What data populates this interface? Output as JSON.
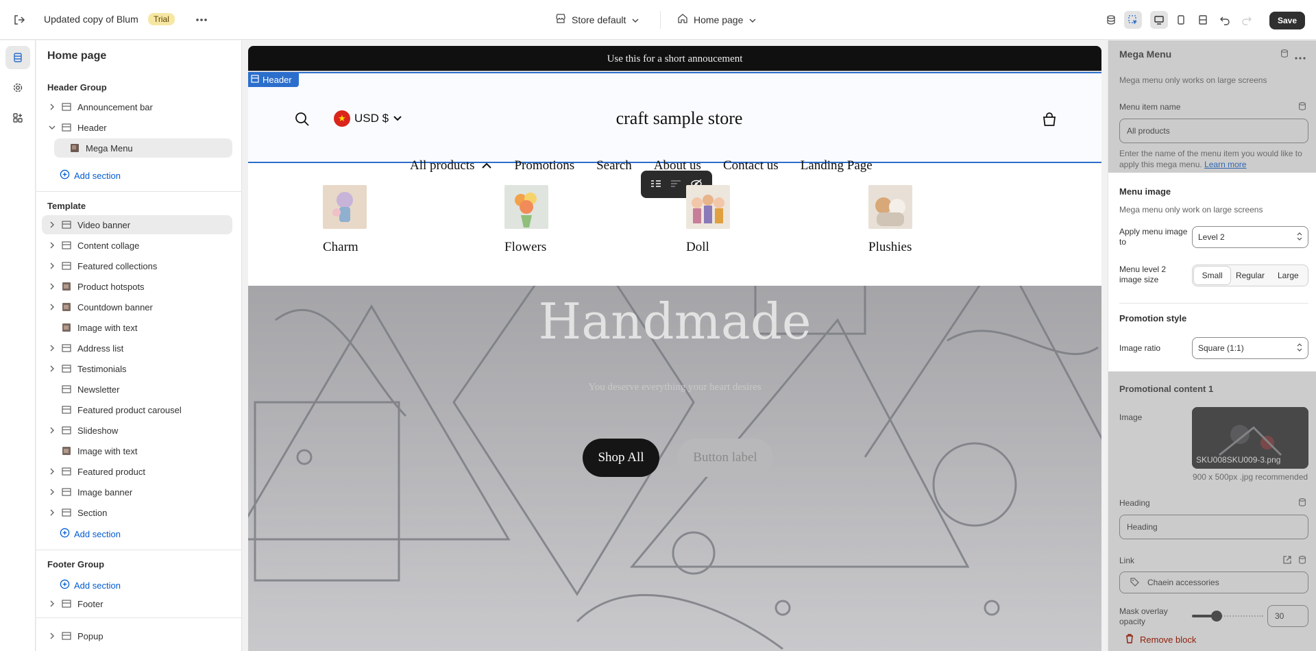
{
  "topbar": {
    "title": "Updated copy of Blum",
    "badge": "Trial",
    "store_selector": "Store default",
    "page_selector": "Home page",
    "save_label": "Save"
  },
  "sidebar": {
    "title": "Home page",
    "header_group": {
      "label": "Header Group",
      "items": [
        "Announcement bar",
        "Header",
        "Mega Menu"
      ],
      "add": "Add section"
    },
    "template": {
      "label": "Template",
      "items": [
        "Video banner",
        "Content collage",
        "Featured collections",
        "Product hotspots",
        "Countdown banner",
        "Image with text",
        "Address list",
        "Testimonials",
        "Newsletter",
        "Featured product carousel",
        "Slideshow",
        "Image with text",
        "Featured product",
        "Image banner",
        "Section"
      ],
      "add": "Add section"
    },
    "footer_group": {
      "label": "Footer Group",
      "add": "Add section",
      "items": [
        "Footer"
      ]
    },
    "popup": "Popup"
  },
  "preview": {
    "announcement": "Use this for a short annoucement",
    "header_tag": "Header",
    "currency": "USD $",
    "store_name": "craft sample store",
    "nav": [
      "All products",
      "Promotions",
      "Search",
      "About us",
      "Contact us",
      "Landing Page"
    ],
    "mega_items": [
      "Charm",
      "Flowers",
      "Doll",
      "Plushies"
    ],
    "hero_title": "Handmade",
    "hero_subtitle": "You deserve everything your heart desires",
    "hero_btn_primary": "Shop All",
    "hero_btn_secondary": "Button label"
  },
  "panel": {
    "title": "Mega Menu",
    "intro": "Mega menu only works on large screens",
    "menu_item_name_label": "Menu item name",
    "menu_item_name_value": "All products",
    "menu_item_help": "Enter the name of the menu item you would like to apply this mega menu.",
    "learn_more": "Learn more",
    "menu_image_heading": "Menu image",
    "menu_image_help": "Mega menu only work on large screens",
    "apply_label": "Apply menu image to",
    "apply_value": "Level 2",
    "size_label": "Menu level 2 image size",
    "size_options": [
      "Small",
      "Regular",
      "Large"
    ],
    "size_selected": "Small",
    "promo_heading": "Promotion style",
    "ratio_label": "Image ratio",
    "ratio_value": "Square (1:1)",
    "promo_content_heading": "Promotional content 1",
    "image_label": "Image",
    "image_filename": "SKU008SKU009-3.png",
    "image_hint": "900 x 500px .jpg recommended",
    "heading_label": "Heading",
    "heading_value": "Heading",
    "link_label": "Link",
    "link_value": "Chaein accessories",
    "overlay_label": "Mask overlay opacity",
    "overlay_value": "30",
    "remove_label": "Remove block"
  }
}
